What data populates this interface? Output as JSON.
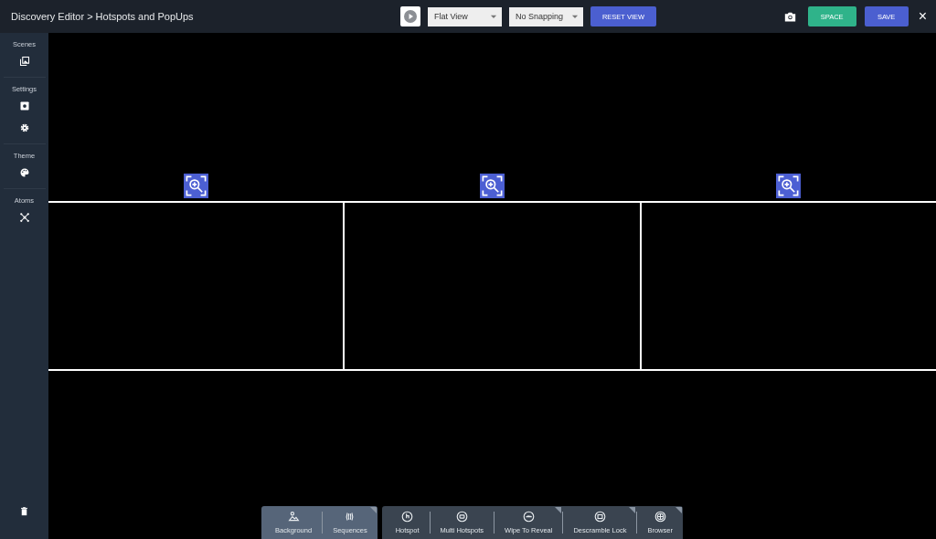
{
  "header": {
    "breadcrumb": "Discovery Editor > Hotspots and PopUps",
    "view_select": "Flat View",
    "snapping_select": "No Snapping",
    "reset_button": "RESET VIEW",
    "space_button": "SPACE",
    "save_button": "SAVE",
    "close": "×"
  },
  "sidebar": {
    "sections": [
      {
        "label": "Scenes"
      },
      {
        "label": "Settings"
      },
      {
        "label": "Theme"
      },
      {
        "label": "Atoms"
      }
    ]
  },
  "panels": [
    {
      "kind": "panel"
    },
    {
      "kind": "panel"
    },
    {
      "kind": "panel"
    }
  ],
  "toolbar": {
    "groups": [
      {
        "highlighted": true,
        "items": [
          {
            "label": "Background",
            "has_menu": false
          },
          {
            "label": "Sequences",
            "has_menu": true
          }
        ]
      },
      {
        "highlighted": false,
        "items": [
          {
            "label": "Hotspot",
            "has_menu": false
          },
          {
            "label": "Multi Hotspots",
            "has_menu": false
          },
          {
            "label": "Wipe To Reveal",
            "has_menu": true
          },
          {
            "label": "Descramble Lock",
            "has_menu": true
          },
          {
            "label": "Browser",
            "has_menu": true
          }
        ]
      }
    ]
  }
}
